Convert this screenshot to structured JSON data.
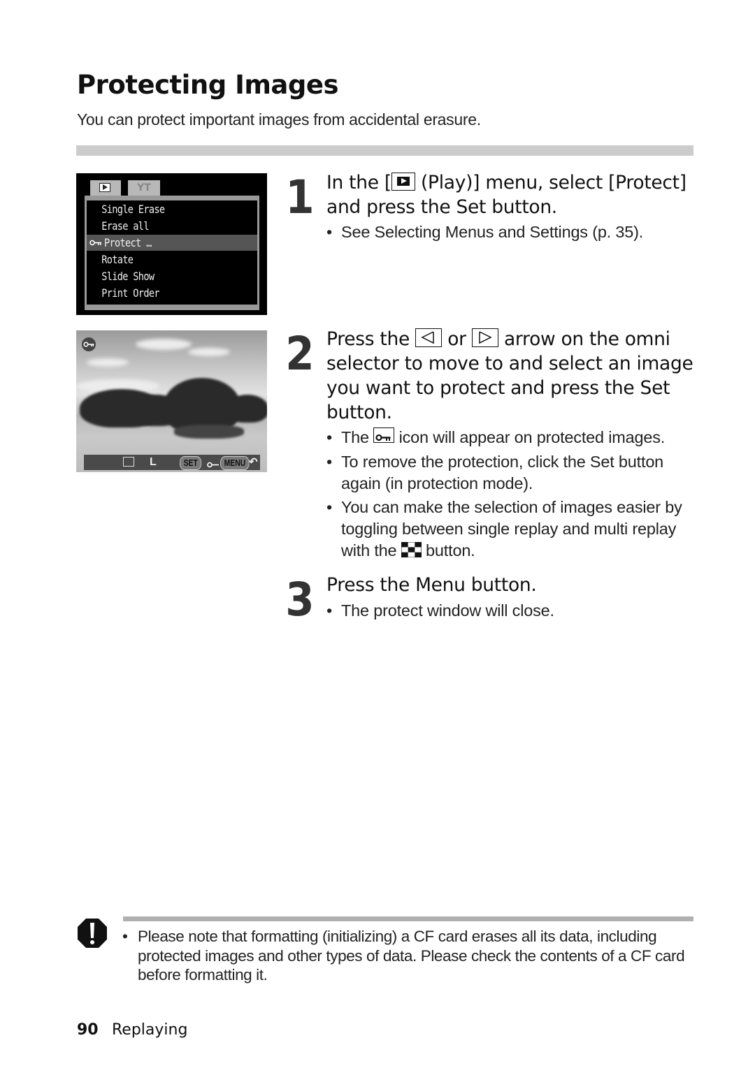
{
  "page": {
    "title": "Protecting Images",
    "intro": "You can protect important images from accidental erasure."
  },
  "camera_menu": {
    "tabs": [
      {
        "name": "play",
        "icon": "play-icon"
      },
      {
        "name": "setup",
        "icon": "wrench-icon",
        "glyph": "ΥΤ"
      }
    ],
    "items": [
      {
        "label": "Single Erase",
        "selected": false
      },
      {
        "label": "Erase all",
        "selected": false
      },
      {
        "label": "Protect …",
        "selected": true,
        "icon": "key-icon"
      },
      {
        "label": "Rotate",
        "selected": false
      },
      {
        "label": "Slide Show",
        "selected": false
      },
      {
        "label": "Print Order",
        "selected": false
      }
    ]
  },
  "photo_screen": {
    "protected_icon": "key-icon",
    "bar": {
      "protect_indicator": "key-box-icon",
      "size_label": "L",
      "set_label": "SET",
      "menu_label": "MENU",
      "return_icon": "return-arrow-icon"
    }
  },
  "steps": [
    {
      "number": "1",
      "heading_pre": "In the [",
      "heading_icon": "play-icon",
      "heading_post": " (Play)] menu, select [Protect]",
      "heading_line2": "and press the Set button.",
      "bullets": [
        "See Selecting Menus and Settings (p. 35)."
      ]
    },
    {
      "number": "2",
      "heading_pre": "Press the ",
      "heading_mid": " or ",
      "heading_post": " arrow on the omni",
      "heading_line2": "selector to move to and select an image",
      "heading_line3": "you want to protect and press the Set",
      "heading_line4": "button.",
      "bullets": [
        {
          "pre": "The ",
          "icon": "key-icon",
          "post": " icon will appear on protected images."
        },
        {
          "line1": "To remove the protection, click the Set button",
          "line2": "again (in protection mode)."
        },
        {
          "line1": "You can make the selection of images easier by",
          "line2": "toggling between single replay and multi replay",
          "line3_pre": "with the ",
          "line3_icon": "index-grid-icon",
          "line3_post": " button."
        }
      ]
    },
    {
      "number": "3",
      "heading": "Press the Menu button.",
      "bullets": [
        "The protect window will close."
      ]
    }
  ],
  "caution": {
    "icon": "caution-icon",
    "bullet": "•",
    "line1": "Please note that formatting (initializing) a CF card erases all its data, including",
    "line2": "protected images and other types of data. Please check the contents of a CF card",
    "line3": "before formatting it."
  },
  "footer": {
    "page_number": "90",
    "section": "Replaying"
  },
  "bullet_char": "•"
}
